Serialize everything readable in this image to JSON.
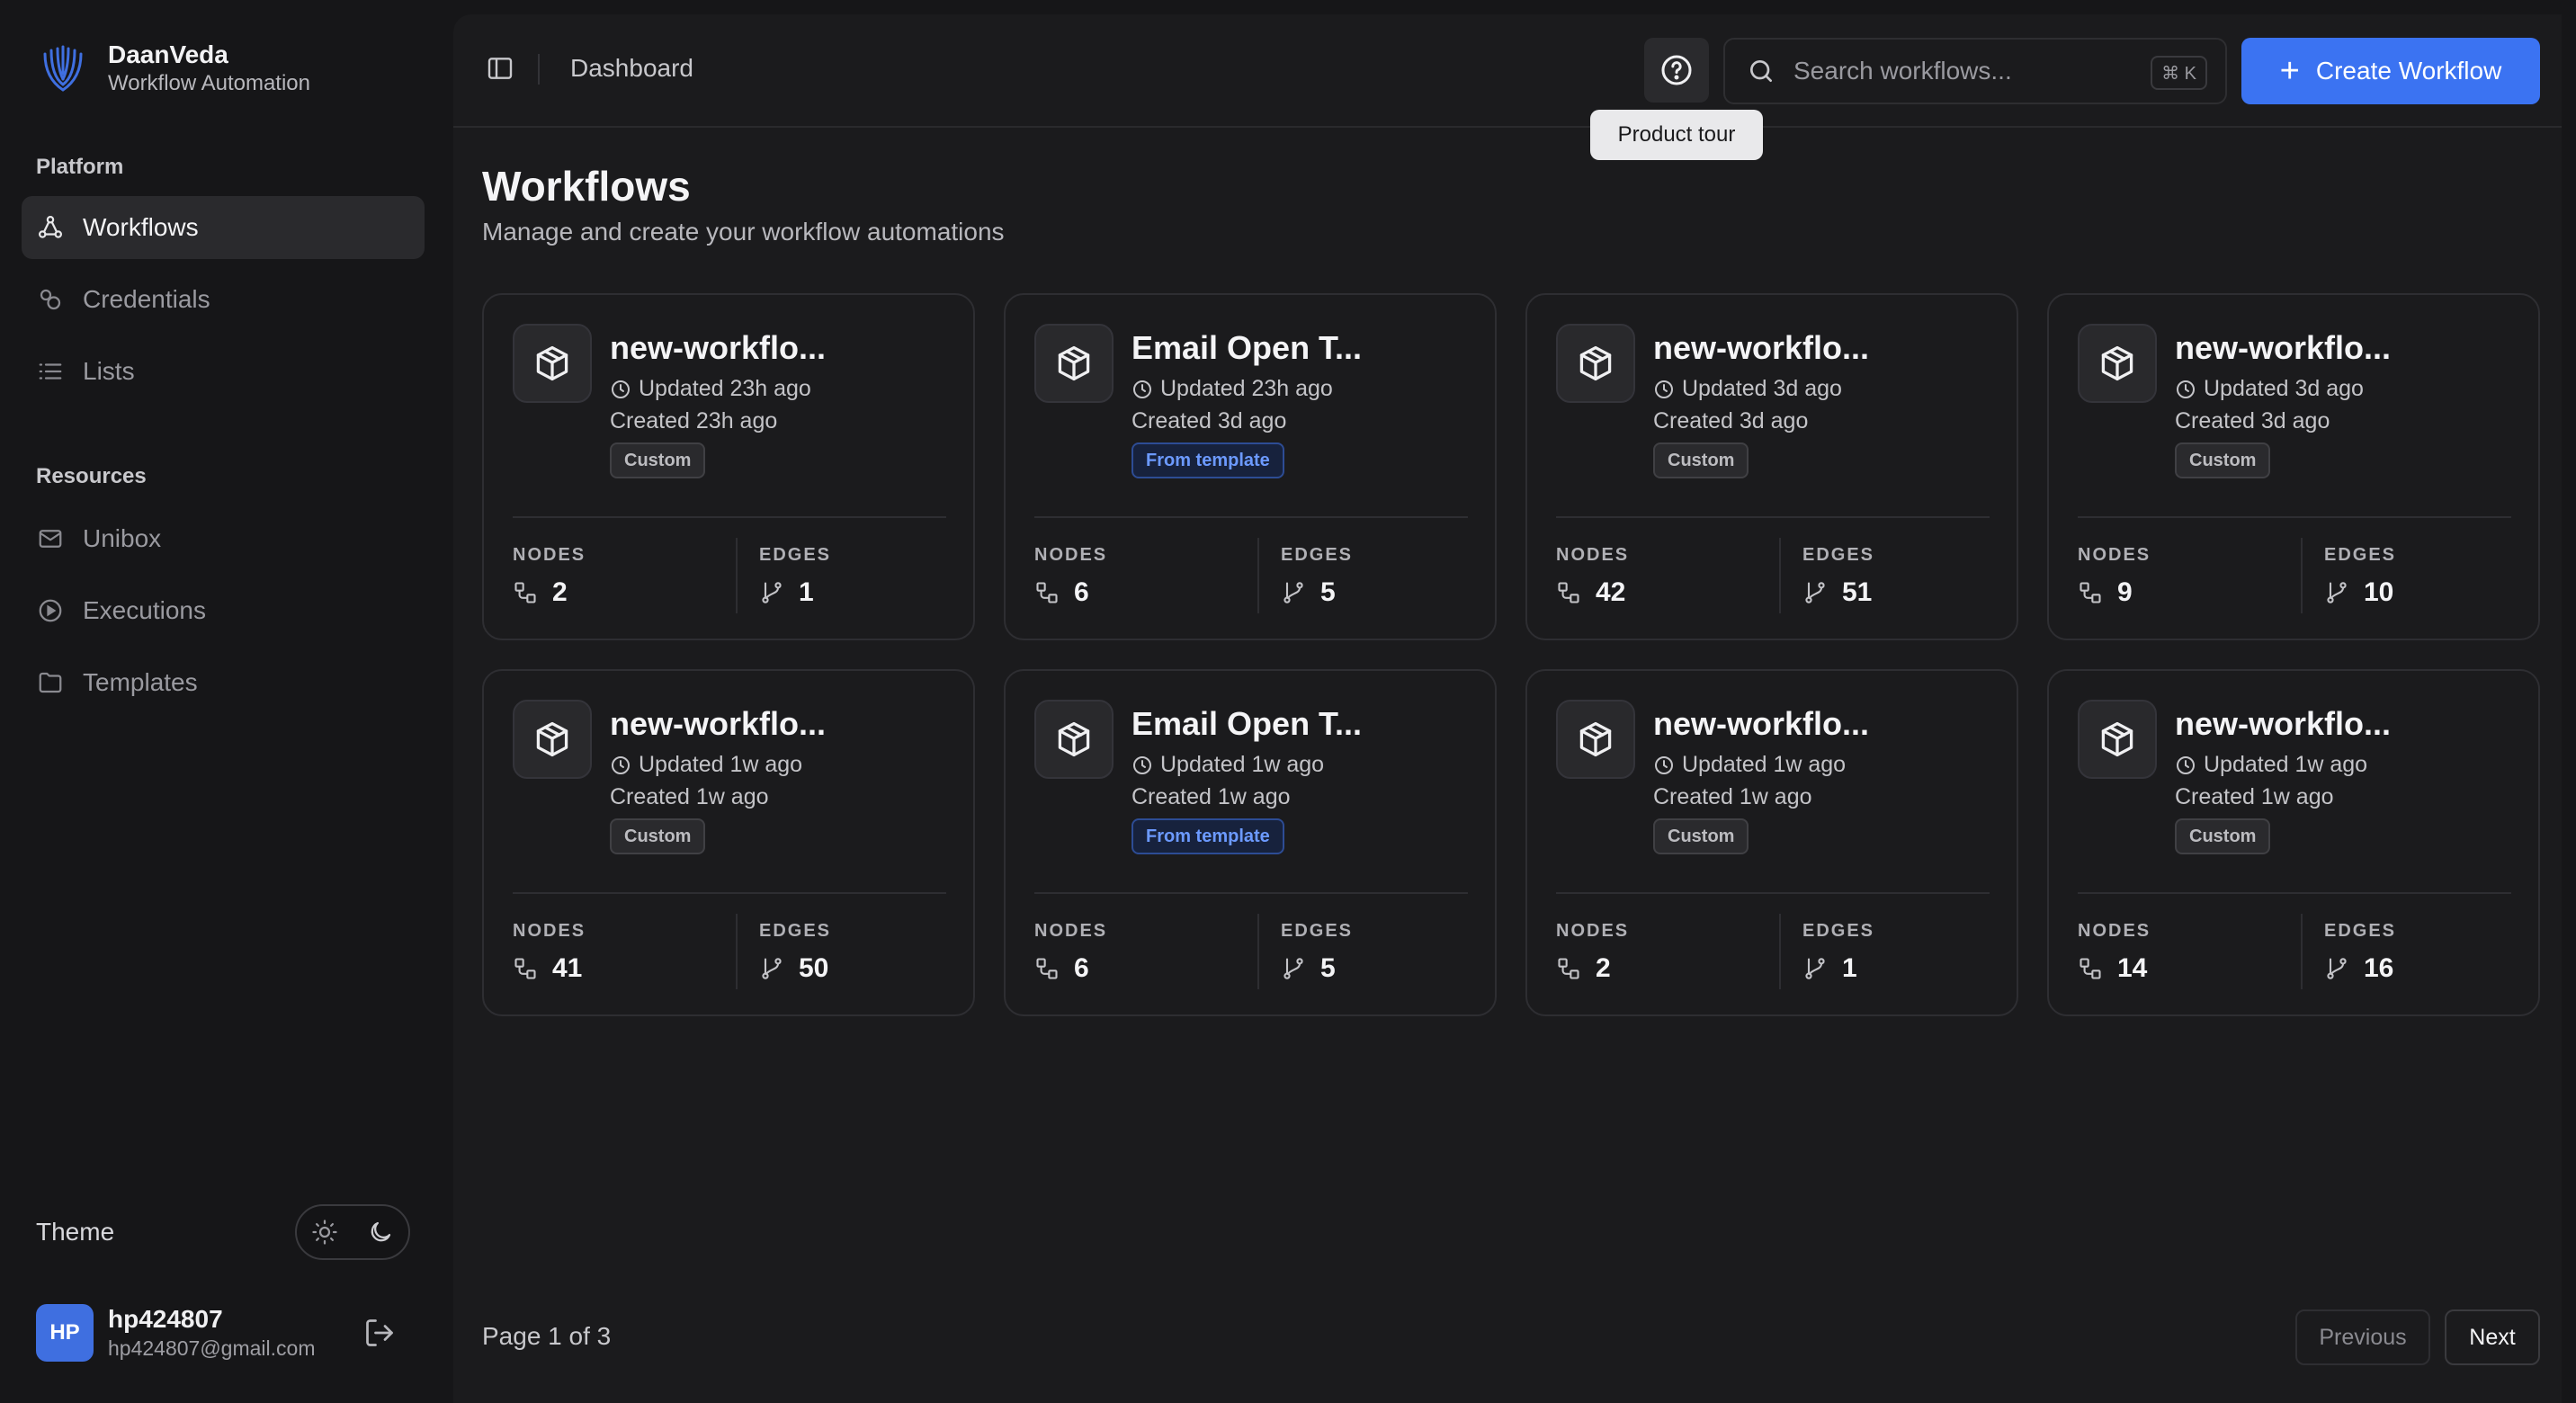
{
  "brand": {
    "name": "DaanVeda",
    "subtitle": "Workflow Automation"
  },
  "sidebar": {
    "platform_label": "Platform",
    "platform_items": [
      {
        "label": "Workflows",
        "icon": "workflow-icon",
        "active": true
      },
      {
        "label": "Credentials",
        "icon": "credentials-icon",
        "active": false
      },
      {
        "label": "Lists",
        "icon": "list-icon",
        "active": false
      }
    ],
    "resources_label": "Resources",
    "resource_items": [
      {
        "label": "Unibox",
        "icon": "mail-icon"
      },
      {
        "label": "Executions",
        "icon": "play-circle-icon"
      },
      {
        "label": "Templates",
        "icon": "folder-icon"
      }
    ],
    "theme_label": "Theme",
    "user": {
      "initials": "HP",
      "name": "hp424807",
      "email": "hp424807@gmail.com"
    }
  },
  "topbar": {
    "breadcrumb": "Dashboard",
    "help_tooltip": "Product tour",
    "search_placeholder": "Search workflows...",
    "search_shortcut": "⌘ K",
    "create_label": "Create Workflow"
  },
  "page": {
    "title": "Workflows",
    "subtitle": "Manage and create your workflow automations"
  },
  "stat_labels": {
    "nodes": "NODES",
    "edges": "EDGES"
  },
  "workflows": [
    {
      "title": "new-workflo...",
      "updated": "Updated 23h ago",
      "created": "Created 23h ago",
      "tag": "Custom",
      "nodes": "2",
      "edges": "1"
    },
    {
      "title": "Email Open T...",
      "updated": "Updated 23h ago",
      "created": "Created 3d ago",
      "tag": "From template",
      "nodes": "6",
      "edges": "5"
    },
    {
      "title": "new-workflo...",
      "updated": "Updated 3d ago",
      "created": "Created 3d ago",
      "tag": "Custom",
      "nodes": "42",
      "edges": "51"
    },
    {
      "title": "new-workflo...",
      "updated": "Updated 3d ago",
      "created": "Created 3d ago",
      "tag": "Custom",
      "nodes": "9",
      "edges": "10"
    },
    {
      "title": "new-workflo...",
      "updated": "Updated 1w ago",
      "created": "Created 1w ago",
      "tag": "Custom",
      "nodes": "41",
      "edges": "50"
    },
    {
      "title": "Email Open T...",
      "updated": "Updated 1w ago",
      "created": "Created 1w ago",
      "tag": "From template",
      "nodes": "6",
      "edges": "5"
    },
    {
      "title": "new-workflo...",
      "updated": "Updated 1w ago",
      "created": "Created 1w ago",
      "tag": "Custom",
      "nodes": "2",
      "edges": "1"
    },
    {
      "title": "new-workflo...",
      "updated": "Updated 1w ago",
      "created": "Created 1w ago",
      "tag": "Custom",
      "nodes": "14",
      "edges": "16"
    }
  ],
  "pagination": {
    "text": "Page 1 of 3",
    "previous": "Previous",
    "next": "Next"
  },
  "colors": {
    "accent": "#3b73f2",
    "template_tag": "#6c9aff",
    "background": "#161618",
    "panel": "#1b1b1d"
  }
}
